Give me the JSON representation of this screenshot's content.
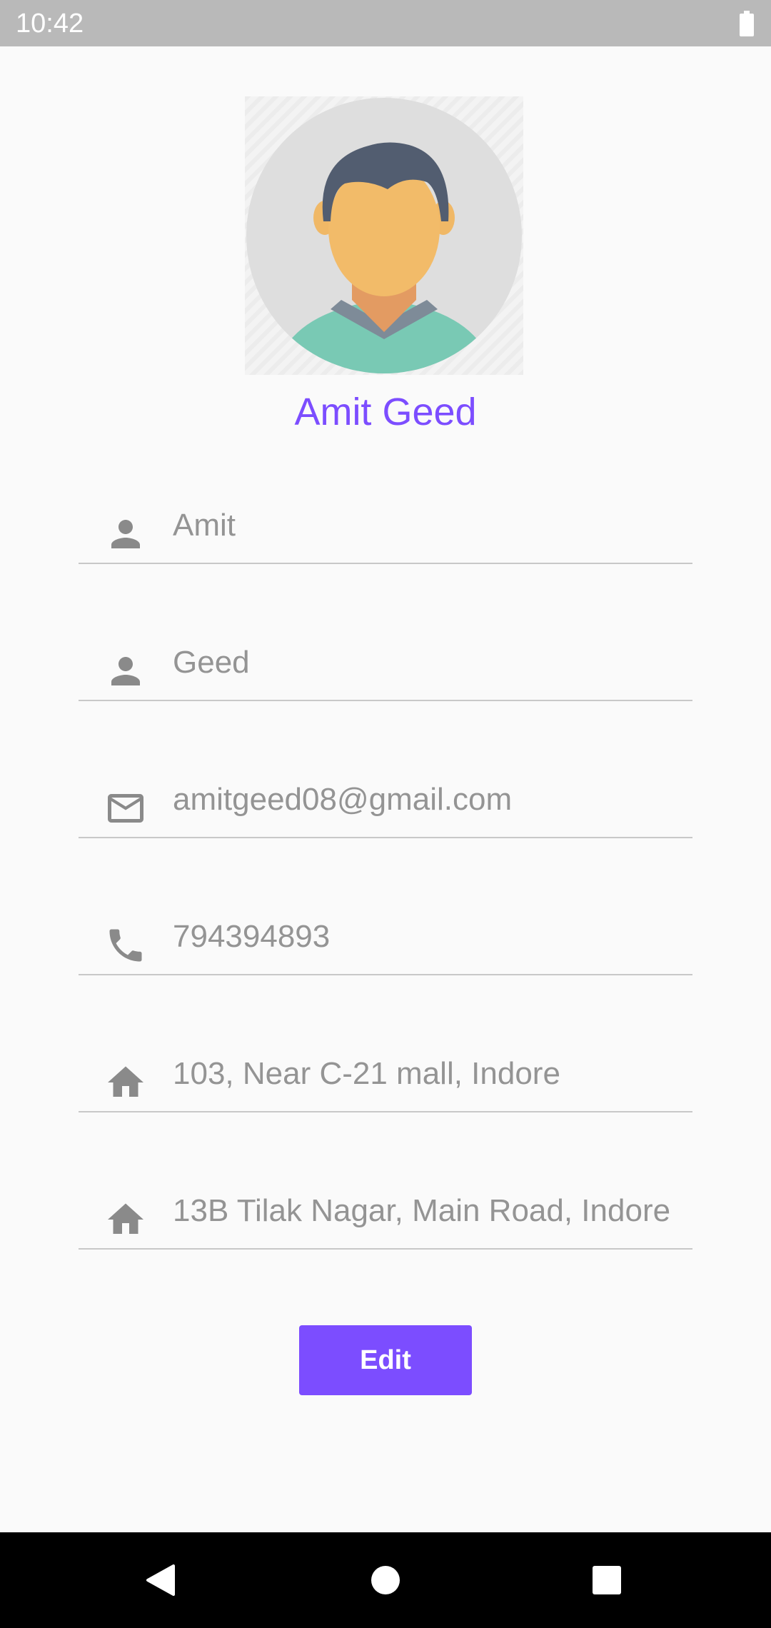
{
  "status_bar": {
    "time": "10:42",
    "battery_icon": "battery-full-icon"
  },
  "profile": {
    "avatar_icon": "avatar-icon",
    "name": "Amit Geed"
  },
  "fields": [
    {
      "icon": "person-icon",
      "value": "Amit"
    },
    {
      "icon": "person-icon",
      "value": "Geed"
    },
    {
      "icon": "email-icon",
      "value": "amitgeed08@gmail.com"
    },
    {
      "icon": "phone-icon",
      "value": "794394893"
    },
    {
      "icon": "home-icon",
      "value": "103, Near C-21 mall, Indore"
    },
    {
      "icon": "home-icon",
      "value": "13B Tilak Nagar, Main Road, Indore"
    }
  ],
  "actions": {
    "edit_label": "Edit"
  },
  "colors": {
    "accent": "#7c4dff",
    "status_bar": "#b9b9b9",
    "field_text": "#949494",
    "icon": "#8a8a8a"
  },
  "nav_bar": {
    "back_icon": "back-icon",
    "home_icon": "home-circle-icon",
    "recents_icon": "recents-icon"
  }
}
